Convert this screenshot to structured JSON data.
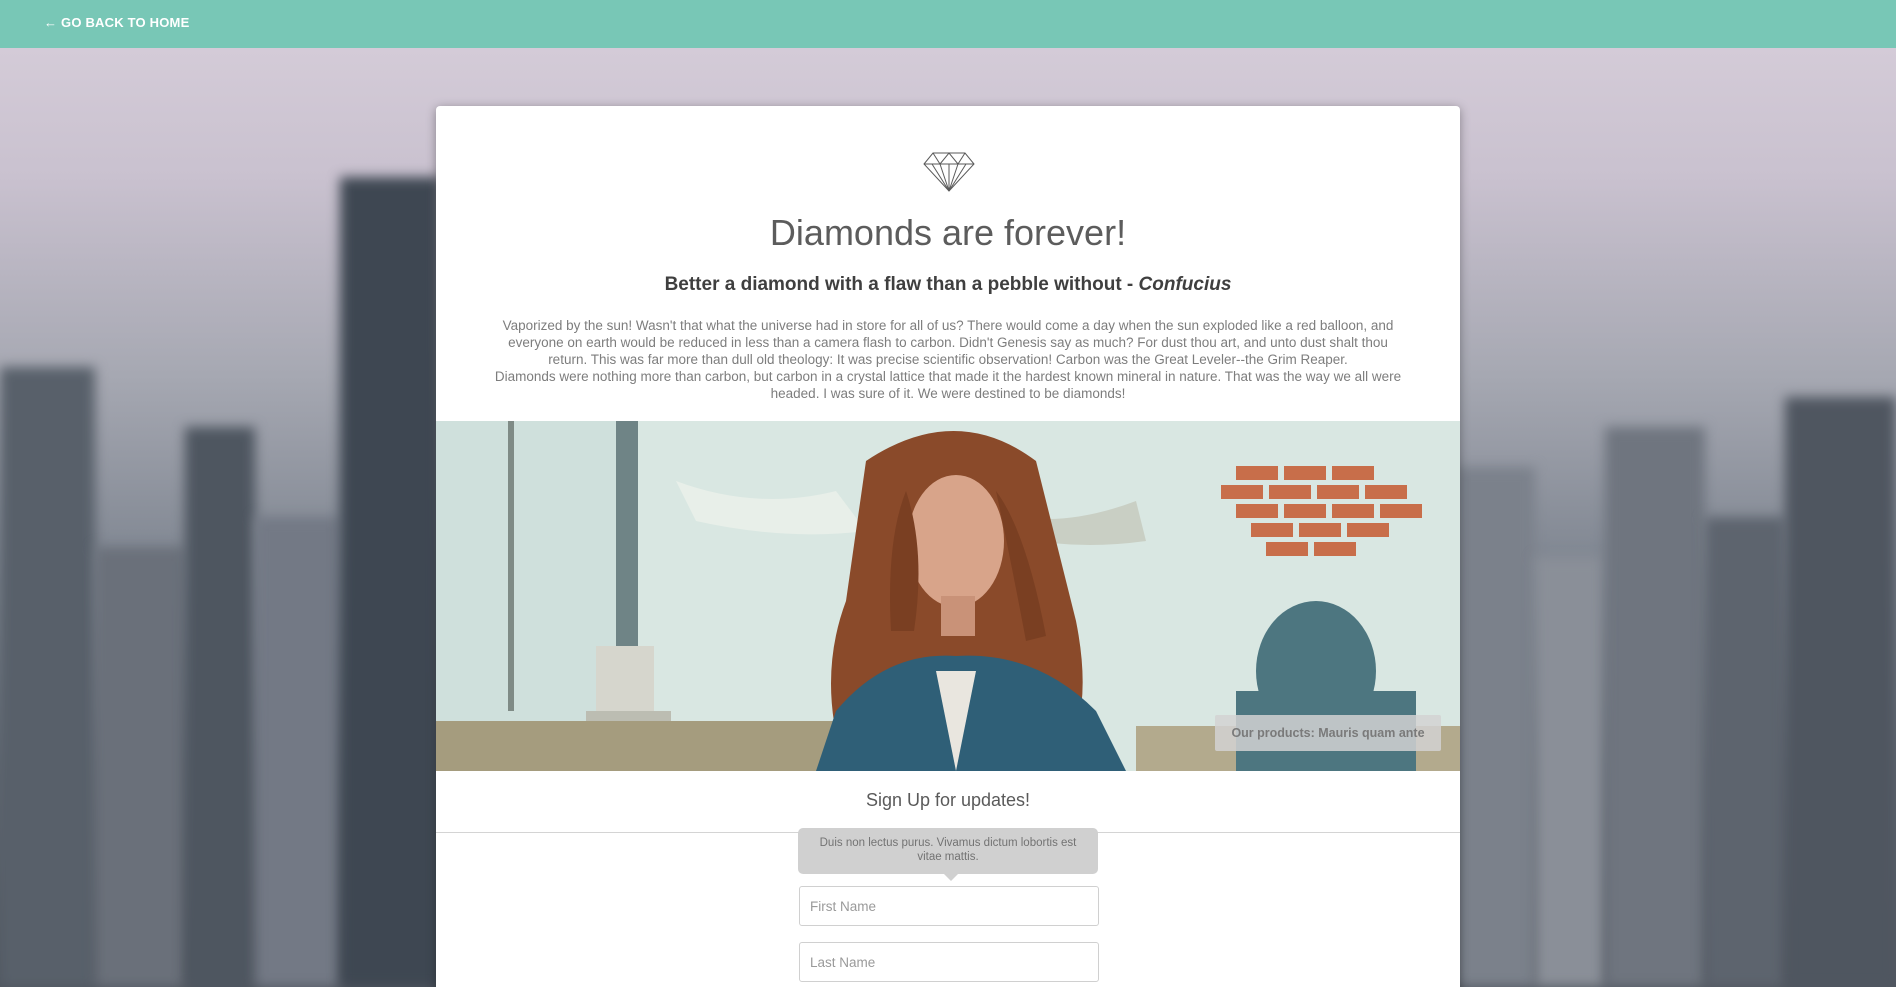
{
  "nav": {
    "back_link": "← GO BACK TO HOME"
  },
  "card": {
    "icon": "diamond-icon",
    "title": "Diamonds are forever!",
    "subtitle_main": "Better a diamond with a flaw than a pebble without - ",
    "subtitle_author": "Confucius",
    "paragraph_1": "Vaporized by the sun! Wasn't that what the universe had in store for all of us? There would come a day when the sun exploded like a red balloon, and everyone on earth would be reduced in less than a camera flash to carbon. Didn't Genesis say as much? For dust thou art, and unto dust shalt thou return. This was far more than dull old theology: It was precise scientific observation! Carbon was the Great Leveler--the Grim Reaper.",
    "paragraph_2": "Diamonds were nothing more than carbon, but carbon in a crystal lattice that made it the hardest known mineral in nature. That was the way we all were headed. I was sure of it. We were destined to be diamonds!",
    "photo_caption": "Our products: Mauris quam ante"
  },
  "signup": {
    "title": "Sign Up for updates!",
    "tooltip": "Duis non lectus purus. Vivamus dictum lobortis est vitae mattis.",
    "first_name_placeholder": "First Name",
    "last_name_placeholder": "Last Name"
  },
  "colors": {
    "topbar": "#78c7b6",
    "card_bg": "#ffffff",
    "tooltip_bg": "#d0d0d0"
  }
}
